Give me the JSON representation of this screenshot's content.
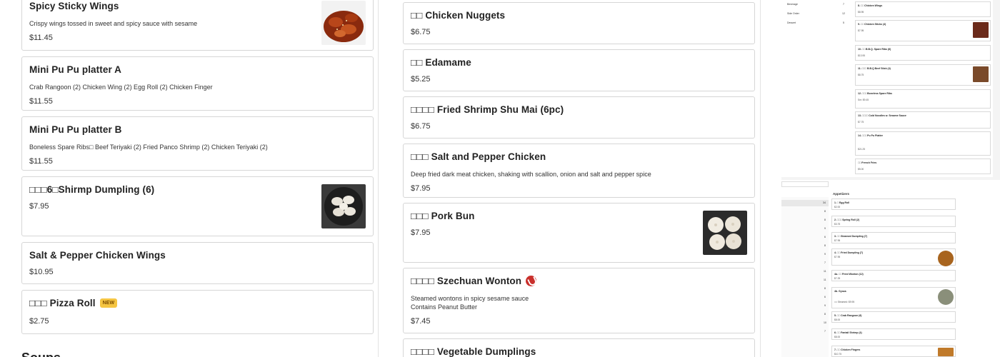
{
  "left_column": {
    "items": [
      {
        "name": "Spicy Sticky Wings",
        "desc": "Crispy wings tossed in sweet and spicy sauce with sesame",
        "price": "$11.45"
      },
      {
        "name": "Mini Pu Pu platter A",
        "desc": "Crab Rangoon (2) Chicken Wing (2) Egg Roll (2) Chicken Finger",
        "price": "$11.55"
      },
      {
        "name": "Mini Pu Pu platter B",
        "desc": "Boneless Spare Ribs□ Beef Teriyaki (2) Fried Panco Shrimp (2) Chicken Teriyaki (2)",
        "price": "$11.55"
      },
      {
        "name": "□□□6□Shirmp Dumpling (6)",
        "price": "$7.95"
      },
      {
        "name": "Salt & Pepper Chicken Wings",
        "price": "$10.95"
      },
      {
        "name": "□□□ Pizza Roll",
        "badge": "NEW",
        "price": "$2.75"
      }
    ],
    "next_section": "Soups"
  },
  "mid_column": {
    "items": [
      {
        "name": "□□ Chicken Nuggets",
        "price": "$6.75"
      },
      {
        "name": "□□ Edamame",
        "price": "$5.25"
      },
      {
        "name": "□□□□ Fried Shrimp Shu Mai (6pc)",
        "price": "$6.75"
      },
      {
        "name": "□□□ Salt and Pepper Chicken",
        "desc": "Deep fried dark meat chicken, shaking with scallion, onion and salt and pepper spice",
        "price": "$7.95"
      },
      {
        "name": "□□□ Pork Bun",
        "price": "$7.95"
      },
      {
        "name": "□□□□ Szechuan Wonton",
        "desc": "Steamed wontons in spicy sesame sauce",
        "note": "Contains Peanut Butter",
        "price": "$7.45"
      },
      {
        "name": "□□□□ Vegetable Dumplings"
      }
    ]
  },
  "right_panel": {
    "top_counts": [
      {
        "label": "Beverage",
        "count": "7"
      },
      {
        "label": "Side Order",
        "count": "12"
      },
      {
        "label": "Dessert",
        "count": "5"
      }
    ],
    "top_items": [
      {
        "name": "8. □□ Chicken Wings",
        "price": "$8.95"
      },
      {
        "name": "9. □□ Chicken Sticks (4)",
        "price": "$7.95"
      },
      {
        "name": "10. □□ B.B.Q. Spare Ribs (6)",
        "price": "$13.95"
      },
      {
        "name": "11. □□□ B.B.Q Beef Stick (4)",
        "price": "$8.75"
      },
      {
        "name": "12. □□□ Boneless Spare Ribs",
        "price": "Sm: $9.45"
      },
      {
        "name": "13. □□□□ Cold Noodles w. Sesame Sauce",
        "price": "$7.75"
      },
      {
        "name": "14. □□□ Pu Pu Platter",
        "price": "$21.25"
      },
      {
        "name": "□□ French Fries",
        "price": "$5.00"
      }
    ],
    "bottom_heading": "Appetizers",
    "bottom_items": [
      {
        "name": "1. □ Egg Roll",
        "price": "$2.00"
      },
      {
        "name": "2. □□□ Spring Roll (2)",
        "price": "$3.75"
      },
      {
        "name": "3. □□ Steamed Dumpling (7)",
        "price": "$7.95"
      },
      {
        "name": "4. □□ Fried Dumpling (7)",
        "price": "$7.95"
      },
      {
        "name": "4a. □□ Fried Wonton (12)",
        "price": "$7.25"
      },
      {
        "name": "4b. Gyoza",
        "price": "□□ Steamed: $9.95"
      },
      {
        "name": "5. □□ Crab Rangoon (6)",
        "price": "$8.00"
      },
      {
        "name": "6. □□ Fantail Shrimp (4)",
        "price": "$8.00"
      },
      {
        "name": "7. □□ Chicken Fingers",
        "price": "$10.75"
      }
    ],
    "sidebar_counts": [
      "34",
      "8",
      "8",
      "9",
      "6",
      "8",
      "9",
      "7",
      "11",
      "11",
      "8",
      "6",
      "9",
      "8",
      "10",
      "7"
    ]
  }
}
